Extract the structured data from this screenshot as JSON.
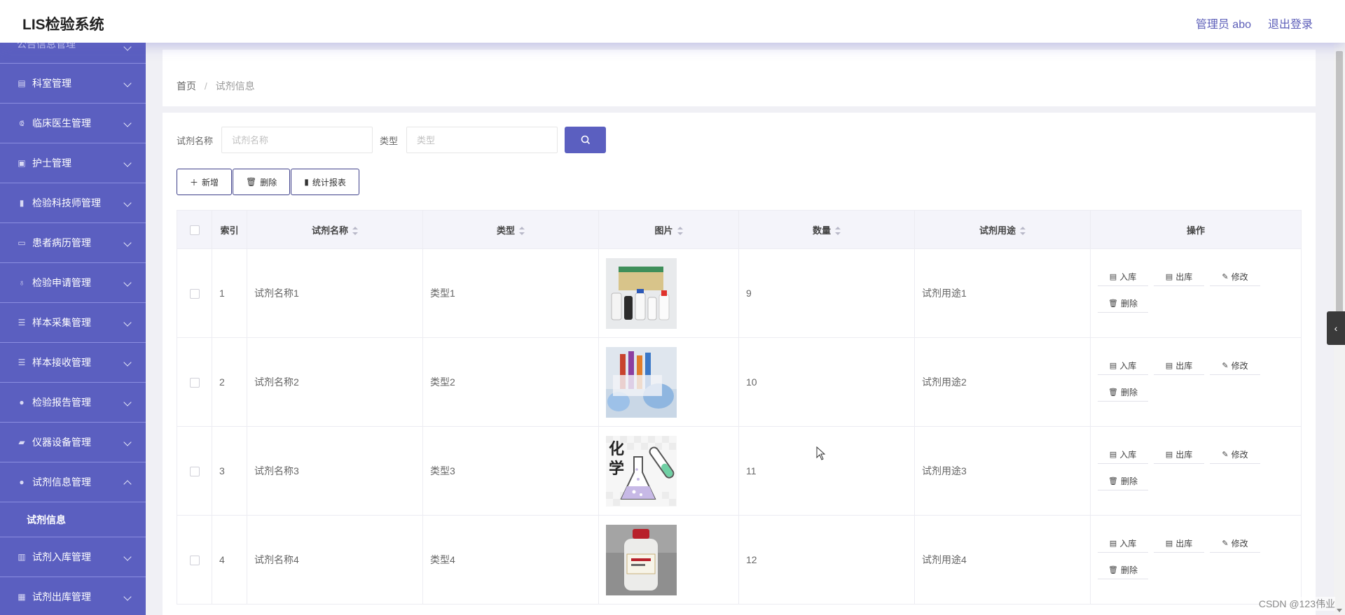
{
  "header": {
    "app_title": "LIS检验系统",
    "user": "管理员 abo",
    "logout": "退出登录"
  },
  "sidebar": {
    "partial_item": "公告信息管理",
    "items": [
      {
        "label": "科室管理",
        "icon": "chart-icon"
      },
      {
        "label": "临床医生管理",
        "icon": "stethoscope-icon"
      },
      {
        "label": "护士管理",
        "icon": "clipboard-icon"
      },
      {
        "label": "检验科技师管理",
        "icon": "bar-chart-icon"
      },
      {
        "label": "患者病历管理",
        "icon": "monitor-icon"
      },
      {
        "label": "检验申请管理",
        "icon": "microphone-icon"
      },
      {
        "label": "样本采集管理",
        "icon": "list-icon"
      },
      {
        "label": "样本接收管理",
        "icon": "list-icon"
      },
      {
        "label": "检验报告管理",
        "icon": "user-icon"
      },
      {
        "label": "仪器设备管理",
        "icon": "ticket-icon"
      },
      {
        "label": "试剂信息管理",
        "icon": "location-icon"
      },
      {
        "label": "试剂入库管理",
        "icon": "columns-icon"
      },
      {
        "label": "试剂出库管理",
        "icon": "grid-icon"
      }
    ],
    "submenu_active": "试剂信息"
  },
  "breadcrumb": {
    "home": "首页",
    "separator": "/",
    "current": "试剂信息"
  },
  "search": {
    "name_label": "试剂名称",
    "name_placeholder": "试剂名称",
    "type_label": "类型",
    "type_placeholder": "类型"
  },
  "toolbar": {
    "add": "新增",
    "delete": "删除",
    "report": "统计报表"
  },
  "table": {
    "headers": [
      "索引",
      "试剂名称",
      "类型",
      "图片",
      "数量",
      "试剂用途",
      "操作"
    ],
    "rows": [
      {
        "index": "1",
        "name": "试剂名称1",
        "type": "类型1",
        "image": "reagent-kit-photo",
        "qty": "9",
        "usage": "试剂用途1"
      },
      {
        "index": "2",
        "name": "试剂名称2",
        "type": "类型2",
        "image": "lab-tubes-photo",
        "qty": "10",
        "usage": "试剂用途2"
      },
      {
        "index": "3",
        "name": "试剂名称3",
        "type": "类型3",
        "image": "chemistry-flask-illustration",
        "qty": "11",
        "usage": "试剂用途3"
      },
      {
        "index": "4",
        "name": "试剂名称4",
        "type": "类型4",
        "image": "reagent-bottle-photo",
        "qty": "12",
        "usage": "试剂用途4"
      }
    ],
    "actions": {
      "stock_in": "入库",
      "stock_out": "出库",
      "edit": "修改",
      "delete": "删除"
    }
  },
  "image_text": {
    "chem_line1": "化",
    "chem_line2": "学"
  },
  "watermark": "CSDN @123伟业",
  "colors": {
    "primary": "#5b5fc0",
    "header_text": "#5b5db8"
  }
}
